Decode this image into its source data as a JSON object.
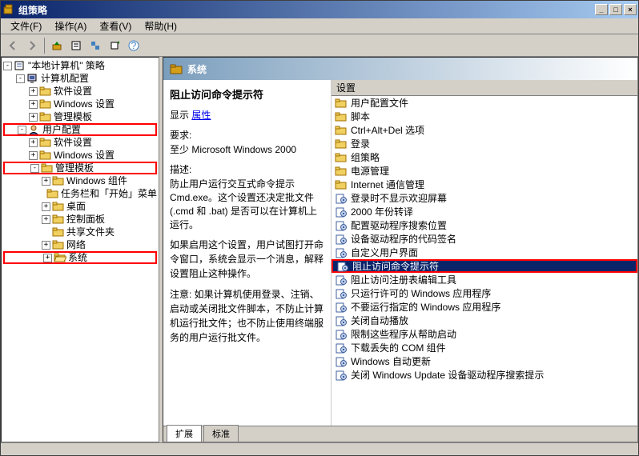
{
  "window": {
    "title": "组策略"
  },
  "menu": {
    "file": "文件(F)",
    "action": "操作(A)",
    "view": "查看(V)",
    "help": "帮助(H)"
  },
  "tree": [
    {
      "level": 0,
      "exp": "-",
      "icon": "policy",
      "label": "\"本地计算机\" 策略"
    },
    {
      "level": 1,
      "exp": "-",
      "icon": "computer",
      "label": "计算机配置"
    },
    {
      "level": 2,
      "exp": "+",
      "icon": "folder",
      "label": "软件设置"
    },
    {
      "level": 2,
      "exp": "+",
      "icon": "folder",
      "label": "Windows 设置"
    },
    {
      "level": 2,
      "exp": "+",
      "icon": "folder",
      "label": "管理模板"
    },
    {
      "level": 1,
      "exp": "-",
      "icon": "user",
      "label": "用户配置",
      "red": true
    },
    {
      "level": 2,
      "exp": "+",
      "icon": "folder",
      "label": "软件设置"
    },
    {
      "level": 2,
      "exp": "+",
      "icon": "folder",
      "label": "Windows 设置"
    },
    {
      "level": 2,
      "exp": "-",
      "icon": "folder",
      "label": "管理模板",
      "red": true
    },
    {
      "level": 3,
      "exp": "+",
      "icon": "folder",
      "label": "Windows 组件"
    },
    {
      "level": 3,
      "exp": " ",
      "icon": "folder",
      "label": "任务栏和「开始」菜单"
    },
    {
      "level": 3,
      "exp": "+",
      "icon": "folder",
      "label": "桌面"
    },
    {
      "level": 3,
      "exp": "+",
      "icon": "folder",
      "label": "控制面板"
    },
    {
      "level": 3,
      "exp": " ",
      "icon": "folder",
      "label": "共享文件夹"
    },
    {
      "level": 3,
      "exp": "+",
      "icon": "folder",
      "label": "网络"
    },
    {
      "level": 3,
      "exp": "+",
      "icon": "folder-open",
      "label": "系统",
      "red": true
    }
  ],
  "rp": {
    "header": "系统",
    "title": "阻止访问命令提示符",
    "show": "显示",
    "props": "属性",
    "req_label": "要求:",
    "req_text": "至少 Microsoft Windows 2000",
    "desc_label": "描述:",
    "desc1": "防止用户运行交互式命令提示 Cmd.exe。这个设置还决定批文件 (.cmd 和 .bat) 是否可以在计算机上运行。",
    "desc2": "如果启用这个设置，用户试图打开命令窗口，系统会显示一个消息，解释设置阻止这种操作。",
    "desc3": "注意: 如果计算机使用登录、注销、启动或关闭批文件脚本，不防止计算机运行批文件；也不防止使用终端服务的用户运行批文件。",
    "listhead": "设置",
    "items": [
      {
        "icon": "folder",
        "label": "用户配置文件"
      },
      {
        "icon": "folder",
        "label": "脚本"
      },
      {
        "icon": "folder",
        "label": "Ctrl+Alt+Del 选项"
      },
      {
        "icon": "folder",
        "label": "登录"
      },
      {
        "icon": "folder",
        "label": "组策略"
      },
      {
        "icon": "folder",
        "label": "电源管理"
      },
      {
        "icon": "folder",
        "label": "Internet 通信管理"
      },
      {
        "icon": "setting",
        "label": "登录时不显示欢迎屏幕"
      },
      {
        "icon": "setting",
        "label": "2000 年份转译"
      },
      {
        "icon": "setting",
        "label": "配置驱动程序搜索位置"
      },
      {
        "icon": "setting",
        "label": "设备驱动程序的代码签名"
      },
      {
        "icon": "setting",
        "label": "自定义用户界面"
      },
      {
        "icon": "setting",
        "label": "阻止访问命令提示符",
        "selected": true,
        "red": true
      },
      {
        "icon": "setting",
        "label": "阻止访问注册表编辑工具"
      },
      {
        "icon": "setting",
        "label": "只运行许可的 Windows 应用程序"
      },
      {
        "icon": "setting",
        "label": "不要运行指定的 Windows 应用程序"
      },
      {
        "icon": "setting",
        "label": "关闭自动播放"
      },
      {
        "icon": "setting",
        "label": "限制这些程序从帮助启动"
      },
      {
        "icon": "setting",
        "label": "下载丢失的 COM 组件"
      },
      {
        "icon": "setting",
        "label": "Windows 自动更新"
      },
      {
        "icon": "setting",
        "label": "关闭 Windows Update 设备驱动程序搜索提示"
      }
    ]
  },
  "tabs": {
    "ext": "扩展",
    "std": "标准"
  }
}
